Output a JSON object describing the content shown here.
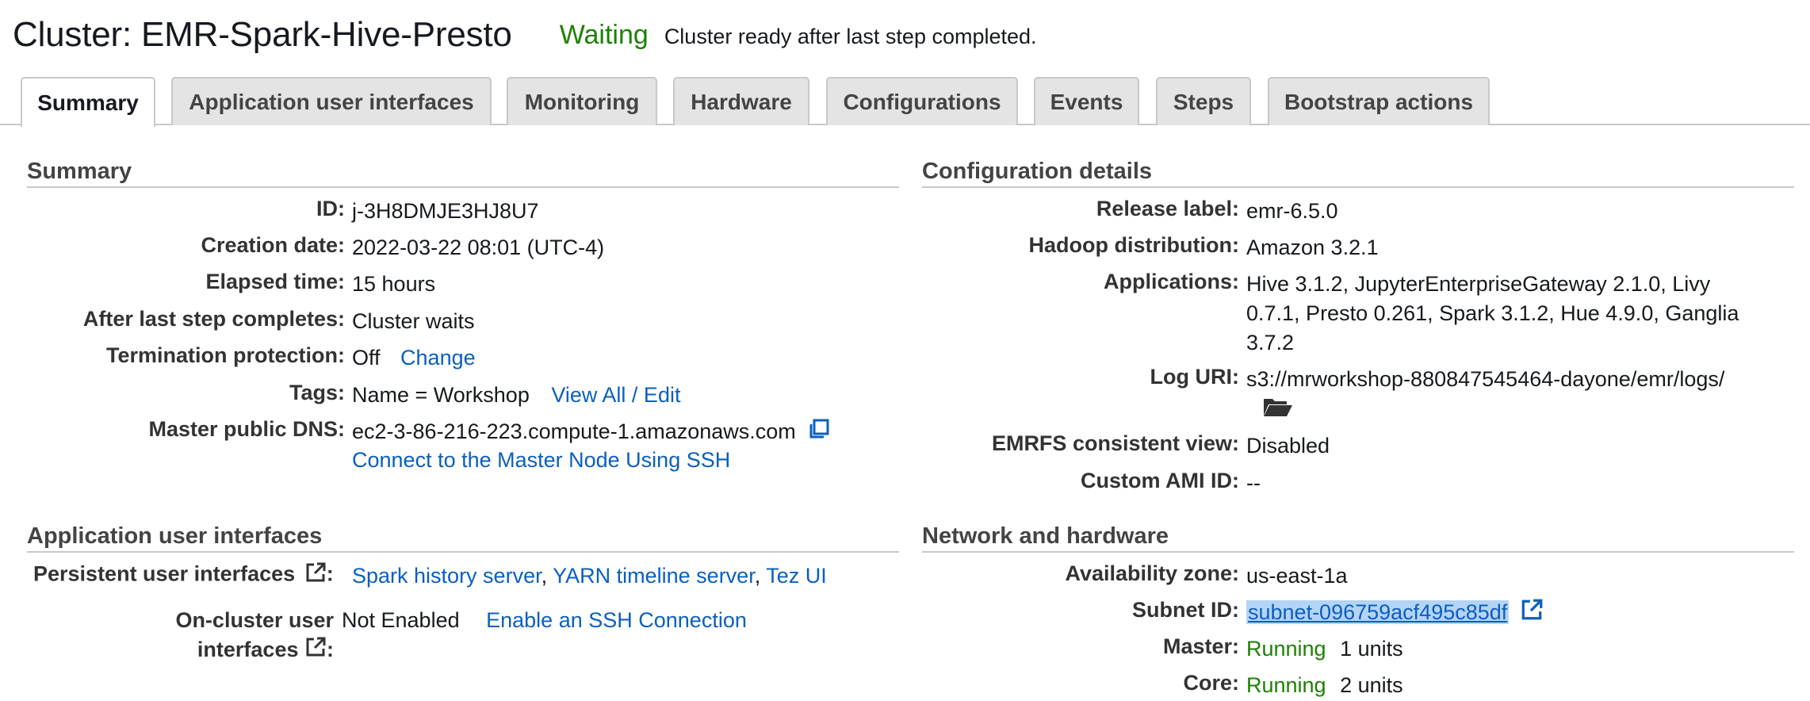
{
  "header": {
    "title": "Cluster: EMR-Spark-Hive-Presto",
    "status": "Waiting",
    "status_message": "Cluster ready after last step completed.",
    "status_color": "#1d8102"
  },
  "tabs": [
    {
      "label": "Summary",
      "active": true
    },
    {
      "label": "Application user interfaces"
    },
    {
      "label": "Monitoring"
    },
    {
      "label": "Hardware"
    },
    {
      "label": "Configurations"
    },
    {
      "label": "Events"
    },
    {
      "label": "Steps"
    },
    {
      "label": "Bootstrap actions"
    }
  ],
  "summary": {
    "title": "Summary",
    "id_label": "ID:",
    "id_value": "j-3H8DMJE3HJ8U7",
    "creation_label": "Creation date:",
    "creation_value": "2022-03-22 08:01 (UTC-4)",
    "elapsed_label": "Elapsed time:",
    "elapsed_value": "15 hours",
    "after_label": "After last step completes:",
    "after_value": "Cluster waits",
    "termination_label": "Termination protection:",
    "termination_value": "Off",
    "termination_change": "Change",
    "tags_label": "Tags:",
    "tags_value": "Name = Workshop",
    "tags_link": "View All / Edit",
    "dns_label": "Master public DNS:",
    "dns_value": "ec2-3-86-216-223.compute-1.amazonaws.com",
    "dns_ssh_link": "Connect to the Master Node Using SSH"
  },
  "config": {
    "title": "Configuration details",
    "release_label": "Release label:",
    "release_value": "emr-6.5.0",
    "hadoop_label": "Hadoop distribution:",
    "hadoop_value": "Amazon 3.2.1",
    "apps_label": "Applications:",
    "apps_value": "Hive 3.1.2, JupyterEnterpriseGateway 2.1.0, Livy 0.7.1, Presto 0.261, Spark 3.1.2, Hue 4.9.0, Ganglia 3.7.2",
    "log_label": "Log URI:",
    "log_value": "s3://mrworkshop-880847545464-dayone/emr/logs/",
    "emrfs_label": "EMRFS consistent view:",
    "emrfs_value": "Disabled",
    "ami_label": "Custom AMI ID:",
    "ami_value": "--"
  },
  "app_ui": {
    "title": "Application user interfaces",
    "persistent_label": "Persistent user interfaces",
    "persistent_colon": ":",
    "spark_link": "Spark history server",
    "yarn_link": "YARN timeline server",
    "tez_link": "Tez UI",
    "sep": ",",
    "oncluster_label_line1": "On-cluster user",
    "oncluster_label_line2": "interfaces",
    "oncluster_colon": ":",
    "oncluster_value": "Not Enabled",
    "oncluster_link": "Enable an SSH Connection"
  },
  "network": {
    "title": "Network and hardware",
    "az_label": "Availability zone:",
    "az_value": "us-east-1a",
    "subnet_label": "Subnet ID:",
    "subnet_value": "subnet-096759acf495c85df",
    "master_label": "Master:",
    "master_status": "Running",
    "master_units": "1 units",
    "core_label": "Core:",
    "core_status": "Running",
    "core_units": "2 units"
  },
  "icons": [
    "copy-icon",
    "folder-open-icon",
    "external-link-icon"
  ],
  "colors": {
    "link": "#0a5fbf",
    "running": "#1d8102",
    "selection": "#b4d4f5"
  }
}
